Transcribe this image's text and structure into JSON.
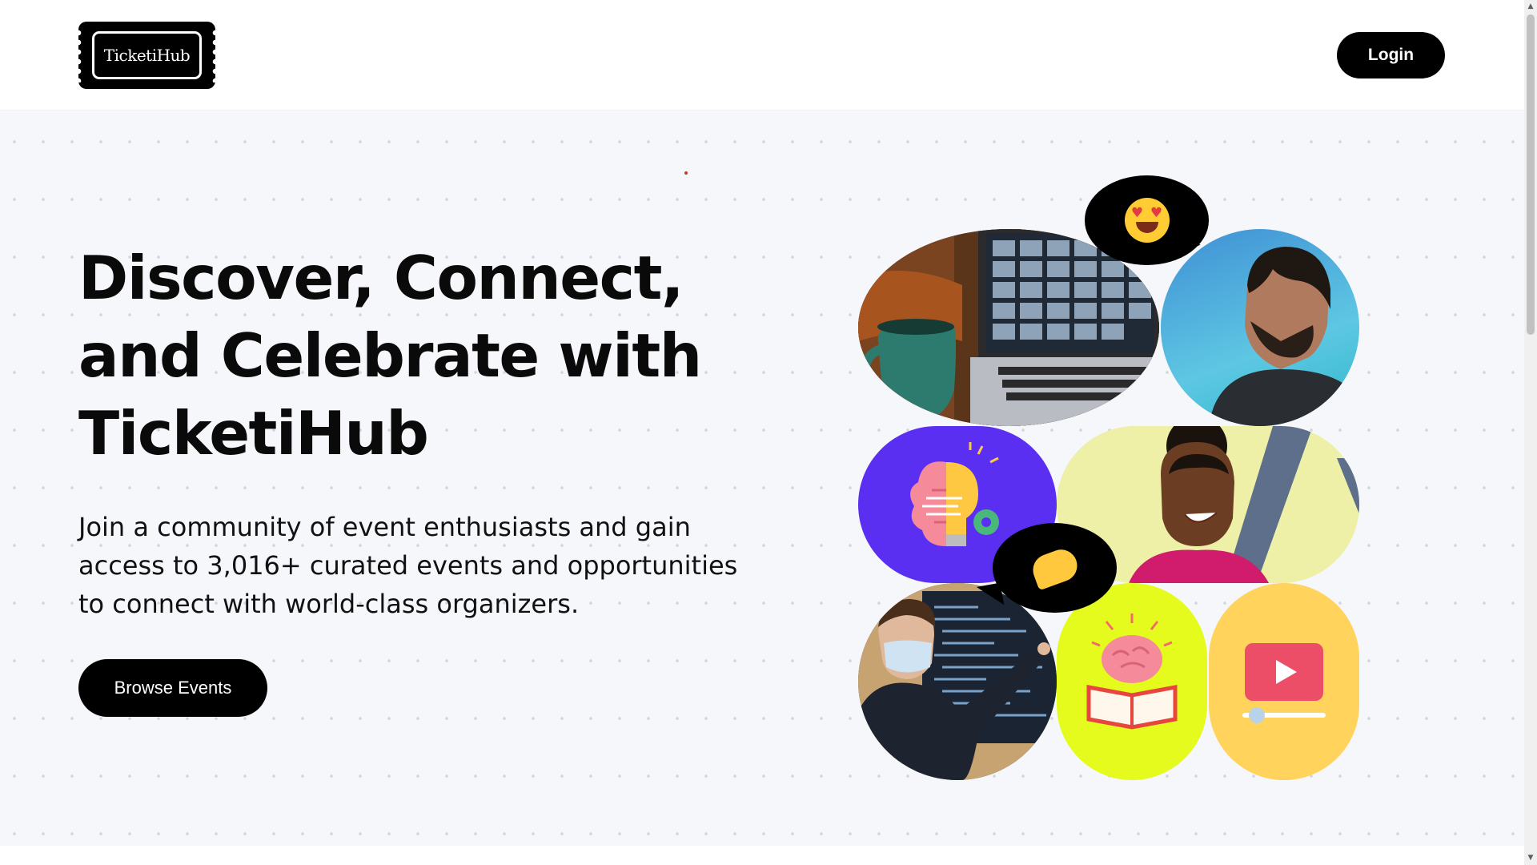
{
  "header": {
    "logo_text": "TicketiHub",
    "login_label": "Login"
  },
  "hero": {
    "title_line1": "Discover, Connect,",
    "title_line2": "and Celebrate with",
    "title_line3": "TicketiHub",
    "subtitle_line1": "Join a community of event enthusiasts and gain",
    "subtitle_line2": "access to 3,016+ curated events and opportunities",
    "subtitle_line3": "to connect with world-class organizers.",
    "browse_label": "Browse Events"
  },
  "collage": {
    "tiles": [
      "laptop-video-call-photo",
      "smiling-man-photo",
      "brain-lightbulb-icon",
      "smiling-woman-photo",
      "presenter-coding-photo",
      "brain-book-icon",
      "video-play-icon"
    ],
    "bubbles": [
      "heart-eyes-emoji",
      "pinching-hand-emoji"
    ]
  },
  "colors": {
    "brand": "#000000",
    "hero_bg": "#f6f7fb",
    "purple": "#5b2ff2",
    "lime": "#e4fb1d",
    "yellow": "#ffd35c"
  }
}
